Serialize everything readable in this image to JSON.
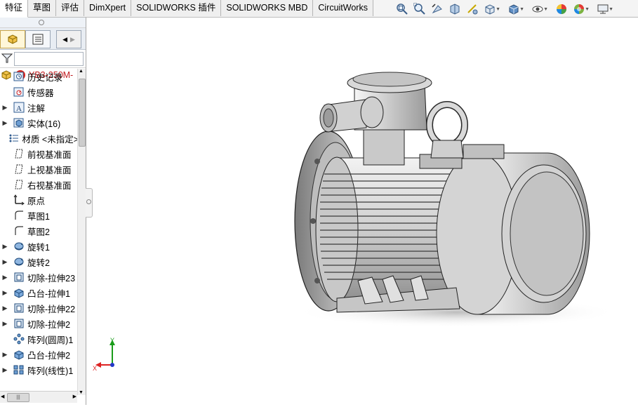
{
  "tabs": [
    "特征",
    "草图",
    "评估",
    "DimXpert",
    "SOLIDWORKS 插件",
    "SOLIDWORKS MBD",
    "CircuitWorks"
  ],
  "active_tab_index": 0,
  "headsup_icons": [
    "zoom-to-fit-icon",
    "zoom-to-area-icon",
    "previous-view-icon",
    "section-view-icon",
    "view-orientation-icon",
    "display-style-icon",
    "hide-show-items-icon",
    "edit-appearance-icon",
    "apply-scene-icon",
    "view-settings-icon"
  ],
  "tree": {
    "root_label": "YB3-250M-",
    "items": [
      {
        "label": "历史记录",
        "icon": "history-icon",
        "expandable": false
      },
      {
        "label": "传感器",
        "icon": "sensor-icon",
        "expandable": false
      },
      {
        "label": "注解",
        "icon": "annotation-icon",
        "expandable": true
      },
      {
        "label": "实体(16)",
        "icon": "solid-bodies-icon",
        "expandable": true
      },
      {
        "label": "材质 <未指定>",
        "icon": "material-icon",
        "expandable": false
      },
      {
        "label": "前视基准面",
        "icon": "plane-icon",
        "expandable": false
      },
      {
        "label": "上视基准面",
        "icon": "plane-icon",
        "expandable": false
      },
      {
        "label": "右视基准面",
        "icon": "plane-icon",
        "expandable": false
      },
      {
        "label": "原点",
        "icon": "origin-icon",
        "expandable": false
      },
      {
        "label": "草图1",
        "icon": "sketch-icon",
        "expandable": false
      },
      {
        "label": "草图2",
        "icon": "sketch-icon",
        "expandable": false
      },
      {
        "label": "旋转1",
        "icon": "revolve-icon",
        "expandable": true
      },
      {
        "label": "旋转2",
        "icon": "revolve-icon",
        "expandable": true
      },
      {
        "label": "切除-拉伸23",
        "icon": "cut-extrude-icon",
        "expandable": true
      },
      {
        "label": "凸台-拉伸1",
        "icon": "boss-extrude-icon",
        "expandable": true
      },
      {
        "label": "切除-拉伸22",
        "icon": "cut-extrude-icon",
        "expandable": true
      },
      {
        "label": "切除-拉伸2",
        "icon": "cut-extrude-icon",
        "expandable": true
      },
      {
        "label": "阵列(圆周)1",
        "icon": "circular-pattern-icon",
        "expandable": false
      },
      {
        "label": "凸台-拉伸2",
        "icon": "boss-extrude-icon",
        "expandable": true
      },
      {
        "label": "阵列(线性)1",
        "icon": "linear-pattern-icon",
        "expandable": true
      }
    ]
  },
  "triad": {
    "y_label": "Y",
    "x_label": "X"
  },
  "colors": {
    "root_text": "#c0191d",
    "accent": "#2f6db5",
    "motor_body": "#d8d8d8"
  }
}
